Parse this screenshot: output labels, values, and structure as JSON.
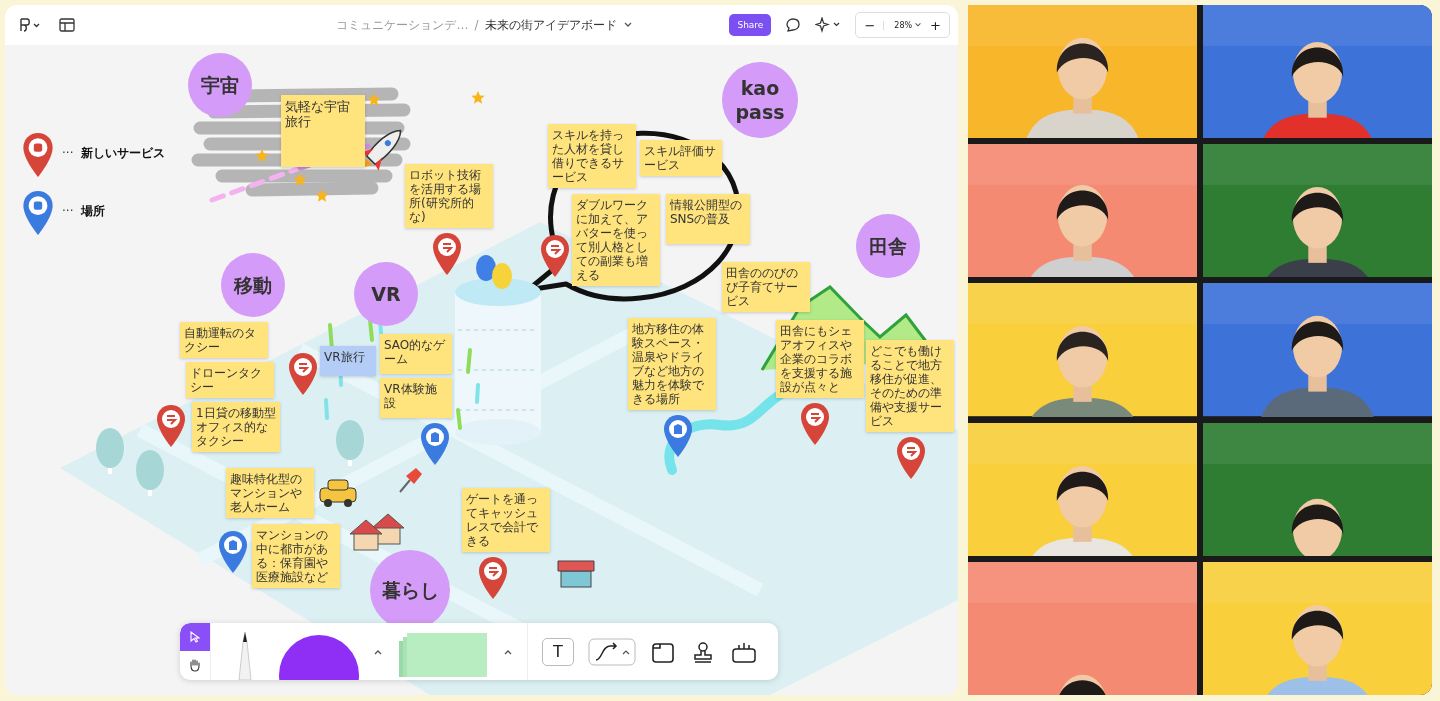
{
  "top_bar": {
    "breadcrumb": "コミュニケーションデ…",
    "separator": "/",
    "title": "未来の街アイデアボード",
    "share": "Share",
    "zoom": "28%",
    "zoom_out": "−",
    "zoom_in": "+"
  },
  "legend": [
    {
      "kind": "service",
      "dots": "···",
      "label": "新しいサービス"
    },
    {
      "kind": "place",
      "dots": "···",
      "label": "場所"
    }
  ],
  "topics": [
    {
      "label": "宇宙"
    },
    {
      "label": "kao pass"
    },
    {
      "label": "田舎"
    },
    {
      "label": "移動"
    },
    {
      "label": "VR"
    },
    {
      "label": "暮らし"
    }
  ],
  "stickies": [
    {
      "text": "気軽な宇宙旅行",
      "color": "#ffe37c"
    },
    {
      "text": "ロボット技術を活用する場所(研究所的な)",
      "color": "#ffe37c"
    },
    {
      "text": "スキルを持った人材を貸し借りできるサービス",
      "color": "#ffe37c"
    },
    {
      "text": "スキル評価サービス",
      "color": "#ffe37c"
    },
    {
      "text": "ダブルワークに加えて、アバターを使って別人格としての副業も増える",
      "color": "#ffe37c"
    },
    {
      "text": "情報公開型のSNSの普及",
      "color": "#ffe37c"
    },
    {
      "text": "田舎ののびのび子育てサービス",
      "color": "#ffe37c"
    },
    {
      "text": "地方移住の体験スペース・温泉やドライブなど地方の魅力を体験できる場所",
      "color": "#ffe37c"
    },
    {
      "text": "田舎にもシェアオフィスや企業のコラボを支援する施設が点々と",
      "color": "#ffe37c"
    },
    {
      "text": "どこでも働けることで地方移住が促進、そのための準備や支援サービス",
      "color": "#ffe37c"
    },
    {
      "text": "自動運転のタクシー",
      "color": "#ffe37c"
    },
    {
      "text": "ドローンタクシー",
      "color": "#ffe37c"
    },
    {
      "text": "1日貸の移動型オフィス的なタクシー",
      "color": "#ffe37c"
    },
    {
      "text": "VR旅行",
      "color": "#b3cdf7"
    },
    {
      "text": "SAO的なゲーム",
      "color": "#ffe37c"
    },
    {
      "text": "VR体験施設",
      "color": "#ffe37c"
    },
    {
      "text": "趣味特化型のマンションや老人ホーム",
      "color": "#ffe37c"
    },
    {
      "text": "マンションの中に都市がある：保育園や医療施設など",
      "color": "#ffe37c"
    },
    {
      "text": "ゲートを通ってキャッシュレスで会計できる",
      "color": "#ffe37c"
    }
  ],
  "pins": [
    {
      "kind": "service"
    },
    {
      "kind": "service"
    },
    {
      "kind": "service"
    },
    {
      "kind": "service"
    },
    {
      "kind": "service"
    },
    {
      "kind": "service"
    },
    {
      "kind": "service"
    },
    {
      "kind": "place"
    },
    {
      "kind": "place"
    },
    {
      "kind": "place"
    }
  ],
  "tools": {
    "text_tool": "T"
  }
}
